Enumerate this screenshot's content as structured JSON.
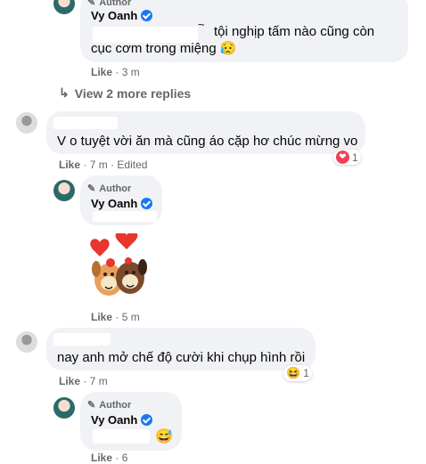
{
  "comments": {
    "reply1": {
      "author_tag": "Author",
      "name": "Vy Oanh",
      "text_line1": "tội nghịp tấm nào cũng còn",
      "text_line2": "cục cơm trong miệng",
      "emoji": "😥",
      "tilde": "~",
      "like_label": "Like",
      "time": "3 m"
    },
    "view_more": {
      "label": "View 2 more replies"
    },
    "comment2": {
      "text": "V o tuyệt vời ăn mà cũng áo cặp hơ chúc mừng vo",
      "like_label": "Like",
      "time": "7 m",
      "edited": "Edited",
      "reaction_icon": "❤",
      "reaction_count": "1"
    },
    "reply2": {
      "author_tag": "Author",
      "name": "Vy Oanh",
      "sticker_name": "hearts-dogs-sticker",
      "like_label": "Like",
      "time": "5 m"
    },
    "comment3": {
      "text": "nay anh mở chế độ cười khi chụp hình rồi",
      "like_label": "Like",
      "time": "7 m",
      "reaction_icon": "😆",
      "reaction_count": "1"
    },
    "reply3": {
      "author_tag": "Author",
      "name": "Vy Oanh",
      "emoji": "😅",
      "like_label": "Like",
      "time": "6"
    }
  },
  "colors": {
    "bubble": "#f0f2f5",
    "meta": "#65676b",
    "verified": "#1877f2",
    "heart": "#f33e58"
  }
}
